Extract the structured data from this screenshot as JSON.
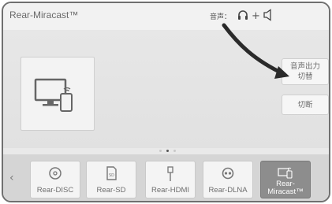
{
  "header": {
    "title": "Rear-Miracast™",
    "audio_label": "音声：",
    "audio_plus": "+",
    "headphone_icon": "headphone-icon",
    "speaker_icon": "speaker-icon"
  },
  "main": {
    "device_icon": "monitor-phone-icon",
    "output_switch_label_line1": "音声出力",
    "output_switch_label_line2": "切替",
    "disconnect_label": "切断"
  },
  "pager": {
    "pages": 3,
    "active_index": 1
  },
  "source_bar": {
    "prev_icon": "chevron-left-icon",
    "sources": [
      {
        "label": "Rear-DISC",
        "icon": "disc-icon",
        "selected": false
      },
      {
        "label": "Rear-SD",
        "icon": "sd-card-icon",
        "selected": false
      },
      {
        "label": "Rear-HDMI",
        "icon": "hdmi-icon",
        "selected": false
      },
      {
        "label": "Rear-DLNA",
        "icon": "dlna-icon",
        "selected": false
      },
      {
        "label": "Rear-\nMiracast™",
        "icon": "miracast-icon",
        "selected": true
      }
    ]
  },
  "colors": {
    "screen_bg": "#e9e9e9",
    "header_bg": "#f2f2f2",
    "source_bar_bg": "#d5d5d5",
    "selected_tile_bg": "#8d8d8d",
    "annotation_arrow": "#2a2a2a"
  }
}
